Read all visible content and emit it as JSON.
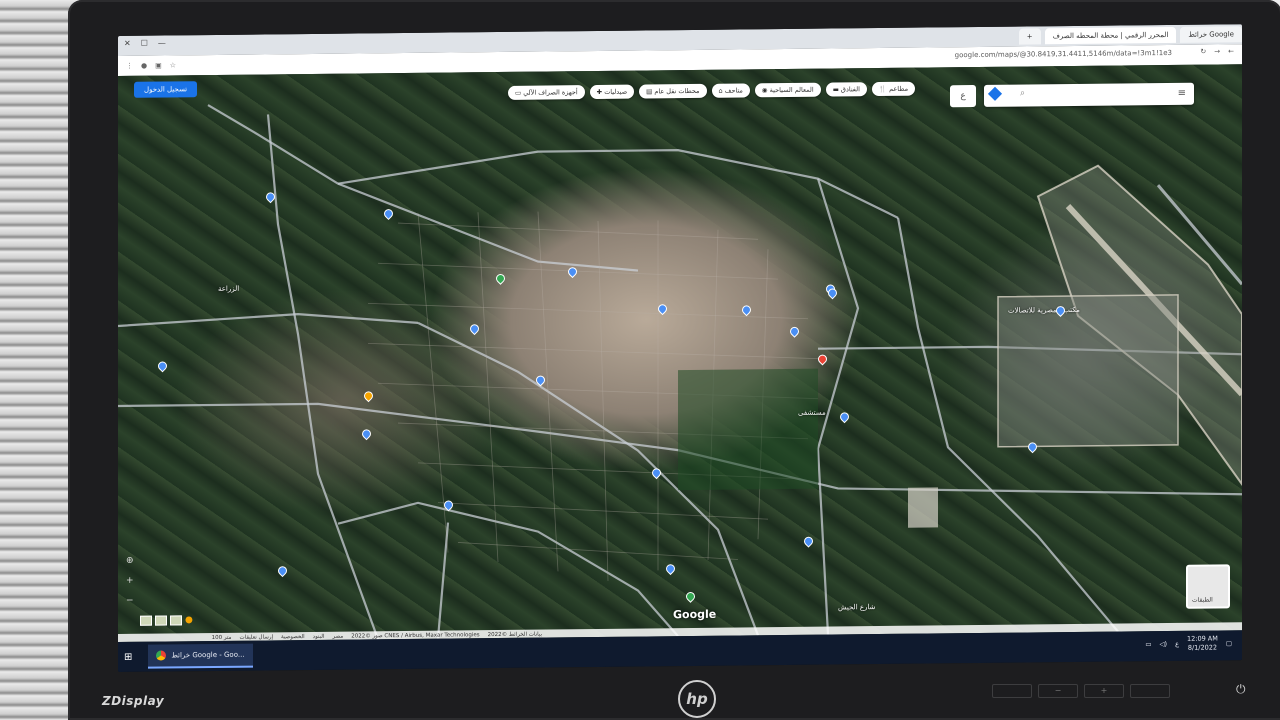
{
  "monitor": {
    "model": "ZDisplay",
    "brand": "hp"
  },
  "browser": {
    "tabs": [
      {
        "label": "خرائط Google",
        "active": false
      },
      {
        "label": "المحرر الرقمي | محطة المحطه الصرف",
        "active": true
      },
      {
        "label": "+",
        "active": false
      }
    ],
    "url": "google.com/maps/@30.8419,31.4411,5146m/data=!3m1!1e3"
  },
  "map": {
    "signin_label": "تسجيل الدخول",
    "search_placeholder": "",
    "chips": [
      {
        "label": "مطاعم",
        "icon": "fork-knife-icon"
      },
      {
        "label": "الفنادق",
        "icon": "bed-icon"
      },
      {
        "label": "المعالم السياحية",
        "icon": "camera-icon"
      },
      {
        "label": "متاحف",
        "icon": "museum-icon"
      },
      {
        "label": "محطات نقل عام",
        "icon": "bus-icon"
      },
      {
        "label": "صيدليات",
        "icon": "pharmacy-icon"
      },
      {
        "label": "أجهزة الصراف الآلي",
        "icon": "atm-icon"
      }
    ],
    "labels": [
      {
        "text": "الزراعة"
      },
      {
        "text": "مكتب المصرية للاتصالات"
      },
      {
        "text": "شارع الجيش"
      },
      {
        "text": "مستشفى"
      }
    ],
    "watermark": "Google",
    "attribution": [
      "بيانات الخرائط ©2022",
      "صور ©2022 CNES / Airbus, Maxar Technologies",
      "مصر",
      "البنود",
      "الخصوصية",
      "إرسال تعليقات",
      "100 متر"
    ],
    "layers_label": "الطبقات"
  },
  "taskbar": {
    "app_label": "خرائط Google - Goo...",
    "time": "12:09 AM",
    "date": "8/1/2022",
    "lang": "ع"
  }
}
